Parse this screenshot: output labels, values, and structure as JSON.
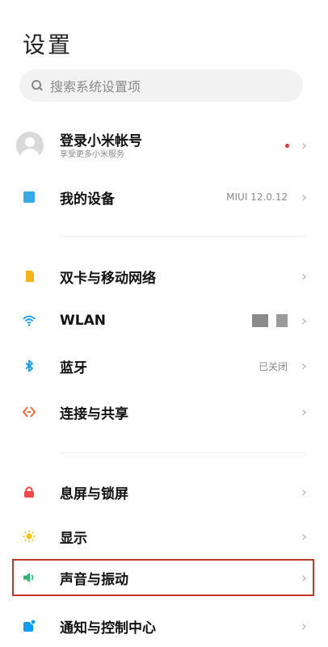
{
  "header": {
    "title": "设置"
  },
  "search": {
    "placeholder": "搜索系统设置项"
  },
  "account": {
    "label": "登录小米帐号",
    "sub": "享受更多小米服务"
  },
  "device": {
    "label": "我的设备",
    "value": "MIUI 12.0.12"
  },
  "network": [
    {
      "label": "双卡与移动网络"
    },
    {
      "label": "WLAN"
    },
    {
      "label": "蓝牙",
      "value": "已关闭"
    },
    {
      "label": "连接与共享"
    }
  ],
  "display": [
    {
      "label": "息屏与锁屏"
    },
    {
      "label": "显示"
    },
    {
      "label": "声音与振动"
    },
    {
      "label": "通知与控制中心"
    }
  ],
  "chevron": "›",
  "colors": {
    "accent": "#0f9cf2",
    "highlight": "#c0392b"
  }
}
